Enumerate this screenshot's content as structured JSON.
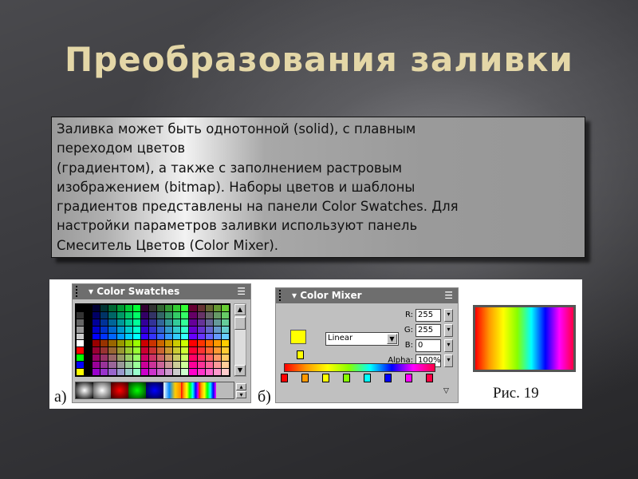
{
  "slide": {
    "title": "Преобразования заливки",
    "body_lines": [
      "Заливка  может  быть  однотонной (solid),  с  плавным",
      "переходом  цветов",
      "(градиентом), а также с заполнением растровым",
      "изображением (bitmap). Наборы цветов  и  шаблоны",
      "градиентов  представлены  на  панели  Color Swatches.  Для",
      "настройки  параметров  заливки  используют  панель",
      "Смеситель  Цветов (Color Mixer)."
    ]
  },
  "figure": {
    "label_a": "а)",
    "label_b": "б)",
    "caption": "Рис. 19",
    "swatches": {
      "title": "Color Swatches",
      "menu_icon": "options-menu-icon"
    },
    "mixer": {
      "title": "Color Mixer",
      "fill_type": "Linear",
      "r_label": "R:",
      "r_value": "255",
      "g_label": "G:",
      "g_value": "255",
      "b_label": "B:",
      "b_value": "0",
      "alpha_label": "Alpha:",
      "alpha_value": "100%",
      "current_color": "#ffff00",
      "gradient_stops": [
        "#ff0000",
        "#ff9900",
        "#ffff00",
        "#88ff00",
        "#00ffff",
        "#0000ff",
        "#ff00ff",
        "#ff0044"
      ]
    }
  }
}
